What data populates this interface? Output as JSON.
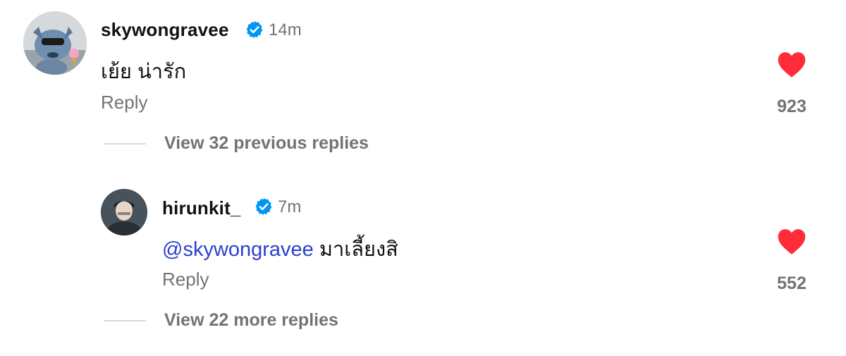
{
  "comments": [
    {
      "username": "skywongravee",
      "verified": true,
      "time": "14m",
      "text": "เย้ย น่ารัก",
      "reply_label": "Reply",
      "likes": "923",
      "liked": true
    }
  ],
  "view_previous": "View 32 previous replies",
  "reply": {
    "username": "hirunkit_",
    "verified": true,
    "time": "7m",
    "mention": "@skywongravee",
    "text": "มาเลี้ยงสิ",
    "reply_label": "Reply",
    "likes": "552",
    "liked": true
  },
  "view_more": "View 22 more replies",
  "colors": {
    "heart": "#ff2d3a",
    "verified": "#0095f6",
    "mention": "#2b3fd1",
    "muted": "#737373"
  }
}
